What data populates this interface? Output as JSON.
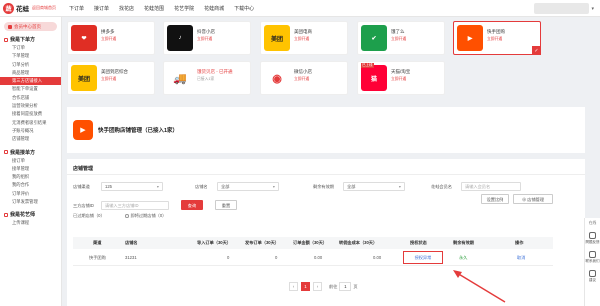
{
  "header": {
    "logo_mark": "蔬",
    "logo_name": "花蛙",
    "logo_sub": "返回商城首页",
    "nav": [
      "下订单",
      "接订单",
      "找花店",
      "花蛙范围",
      "花艺学院",
      "花蛙商城",
      "下载中心"
    ]
  },
  "sidebar": {
    "home": "会员中心首页",
    "groups": [
      {
        "title": "我是下单方",
        "items": [
          "下订单",
          "下单管理",
          "订单分析",
          "商品管理",
          "第三方店铺接入",
          "智能下单设置",
          "合作店铺",
          "运营效果分析",
          "接着同是投放费",
          "无消费者吸引结果",
          "子账号概况",
          "店铺管理"
        ]
      },
      {
        "title": "我是接单方",
        "items": [
          "接订单",
          "接单管理",
          "我的组织",
          "我的合作",
          "订单评价",
          "订单发票管理"
        ]
      },
      {
        "title": "我是花艺师",
        "items": [
          "上传课程"
        ]
      }
    ],
    "active": "第三方店铺接入"
  },
  "platforms": [
    {
      "name": "拼多多",
      "status": "立即开通",
      "icon": "pdd-icon",
      "color": "#e02e24",
      "glyph": "❤"
    },
    {
      "name": "抖音小店",
      "status": "立即开通",
      "icon": "douyin-icon",
      "color": "#111111",
      "glyph": "♪"
    },
    {
      "name": "美团电商",
      "status": "立即开通",
      "icon": "meituan-icon",
      "color": "#ffc300",
      "glyph": "美团"
    },
    {
      "name": "饿了么",
      "status": "立即开通",
      "icon": "eleme-icon",
      "color": "#1d9f4c",
      "glyph": "✔"
    },
    {
      "name": "快手团购",
      "status": "立即开通",
      "icon": "kuaishou-icon",
      "color": "#ff5000",
      "glyph": "▶",
      "selected": true
    },
    {
      "name": "美团到店综合",
      "status": "立即开通",
      "icon": "meituan-store-icon",
      "color": "#ffc300",
      "glyph": "美团"
    },
    {
      "name": "饿货贝店 - 已开通",
      "status": "已接入1家",
      "icon": "truck-icon",
      "color": "#ffffff",
      "glyph": "🚚"
    },
    {
      "name": "微信小店",
      "status": "立即开通",
      "icon": "wechat-shop-icon",
      "color": "#ffffff",
      "glyph": "◉"
    },
    {
      "name": "天猫/淘宝",
      "status": "立即开通",
      "icon": "tmall-icon",
      "color": "#ff0036",
      "glyph": "猫",
      "tag": "已上线"
    }
  ],
  "store_header": {
    "title": "快手团购店铺管理（已接入1家）"
  },
  "panel": {
    "title": "店铺管理",
    "filters": {
      "channel_label": "店铺渠道",
      "channel_value": "125",
      "store_label": "店铺名",
      "store_value": "全部",
      "expire_label": "剩余有效期",
      "expire_value": "全部",
      "member_label": "花蛙会员名",
      "member_placeholder": "请输入会员名",
      "thirdparty_label": "三方店铺ID",
      "thirdparty_placeholder": "请输入三方店铺ID",
      "search_btn": "查询",
      "reset_btn": "重置",
      "setting_btn": "设置比例",
      "manage_btn": "⊕ 店铺管理"
    },
    "tabs": [
      "已过期店铺（0）",
      "即将过期店铺（0）"
    ],
    "columns": [
      "渠道",
      "店铺名",
      "导入订单（30天）",
      "发布订单（30天）",
      "订单金额（30天）",
      "转佣金成本（30天）",
      "授权状态",
      "剩余有效期",
      "操作"
    ],
    "rows": [
      [
        "快手团购",
        "31231",
        "0",
        "0",
        "0.00",
        "0.00",
        "授权异常",
        "永久",
        "取消"
      ]
    ],
    "pager": {
      "prev": "‹",
      "current": "1",
      "next": "›",
      "goto_label": "前往",
      "goto_value": "1",
      "page_label": "页"
    }
  },
  "float": {
    "head": "在线",
    "items": [
      "問题反馈",
      "联系我们",
      "建议"
    ]
  }
}
